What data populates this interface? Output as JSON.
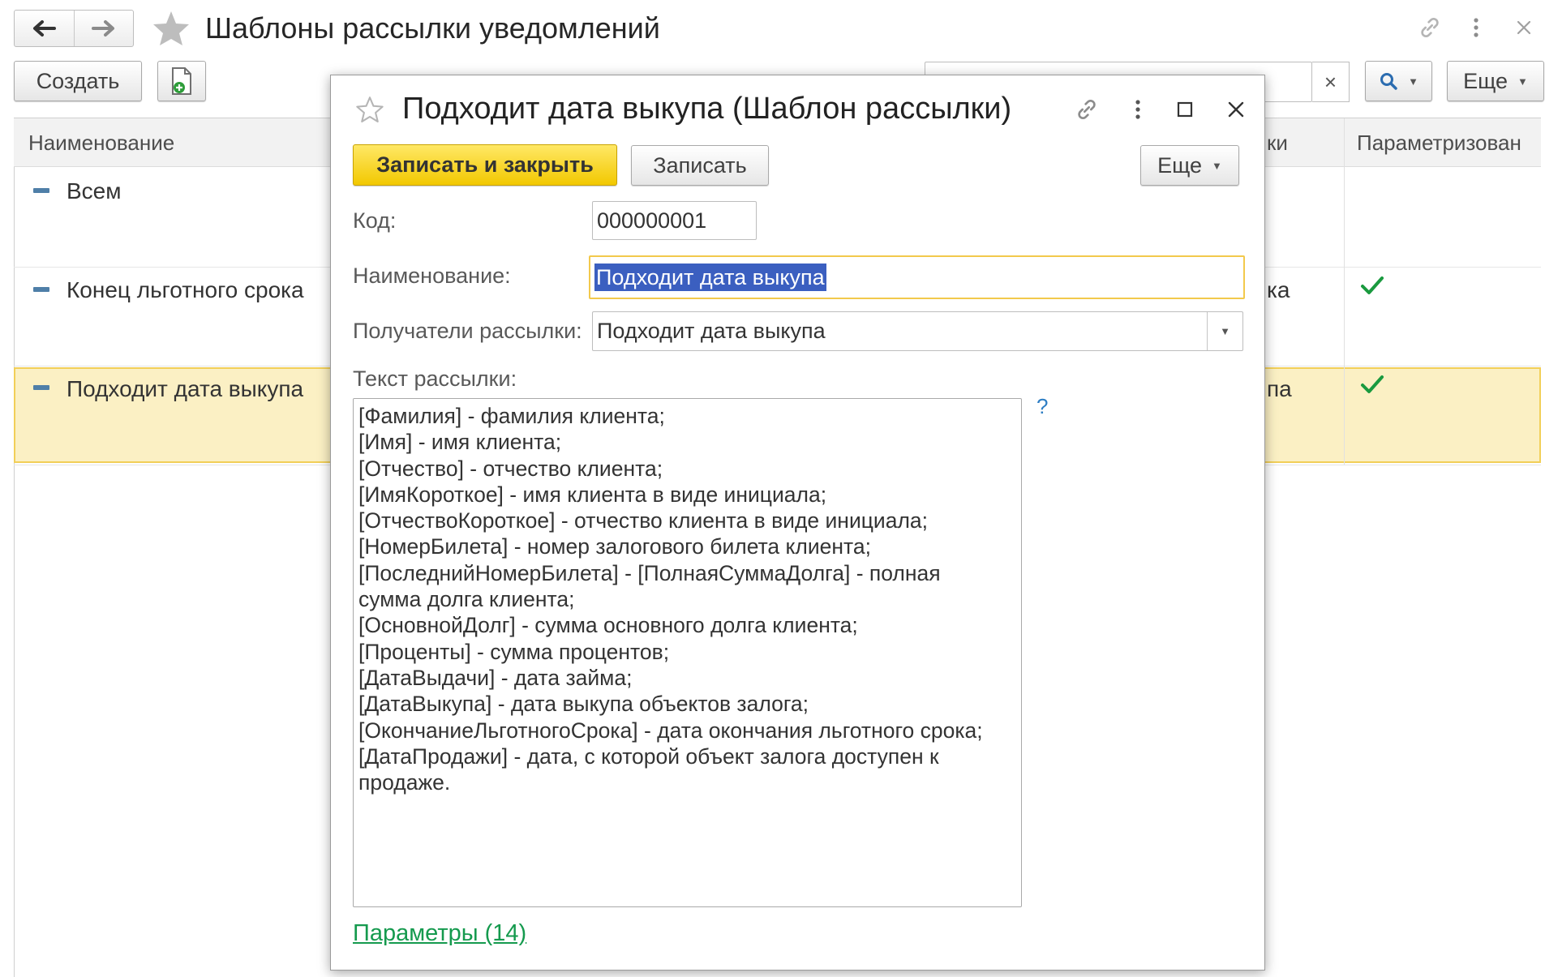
{
  "window": {
    "title": "Шаблоны рассылки уведомлений",
    "create_label": "Создать",
    "more_label": "Еще",
    "search_clear_label": "×"
  },
  "list": {
    "columns": [
      "Наименование",
      "ки",
      "Параметризован"
    ],
    "rows": [
      {
        "name": "Всем",
        "partial": "",
        "parametrized": false
      },
      {
        "name": "Конец льготного срока",
        "partial": "ка",
        "parametrized": true
      },
      {
        "name": "Подходит дата выкупа",
        "partial": "па",
        "parametrized": true,
        "selected": true
      }
    ]
  },
  "dialog": {
    "title": "Подходит дата выкупа (Шаблон рассылки)",
    "save_close_label": "Записать и закрыть",
    "save_label": "Записать",
    "more_label": "Еще",
    "code_label": "Код:",
    "code_value": "000000001",
    "name_label": "Наименование:",
    "name_value": "Подходит дата выкупа",
    "recipients_label": "Получатели рассылки:",
    "recipients_value": "Подходит дата выкупа",
    "text_label": "Текст рассылки:",
    "text_lines": [
      "[Фамилия] - фамилия клиента;",
      "[Имя] - имя клиента;",
      "[Отчество] - отчество клиента;",
      "[ИмяКороткое] - имя клиента в виде инициала;",
      "[ОтчествоКороткое] - отчество клиента в виде инициала;",
      "[НомерБилета] - номер залогового билета клиента;",
      "[ПоследнийНомерБилета] - [ПолнаяСуммаДолга] - полная",
      "сумма долга клиента;",
      "[ОсновнойДолг] - сумма основного долга клиента;",
      "[Проценты] - сумма процентов;",
      "[ДатаВыдачи] - дата займа;",
      "[ДатаВыкупа] - дата выкупа объектов залога;",
      "[ОкончаниеЛьготногоСрока] - дата окончания льготного срока;",
      "[ДатаПродажи] - дата, с которой объект залога доступен к",
      "продаже."
    ],
    "help_label": "?",
    "params_link": "Параметры (14)"
  },
  "colors": {
    "accent_yellow": "#f2c800",
    "selection_row": "#fbf0c4",
    "check_green": "#1a9a3f",
    "link_green": "#159a4e",
    "text_selection": "#3b5fc0"
  }
}
